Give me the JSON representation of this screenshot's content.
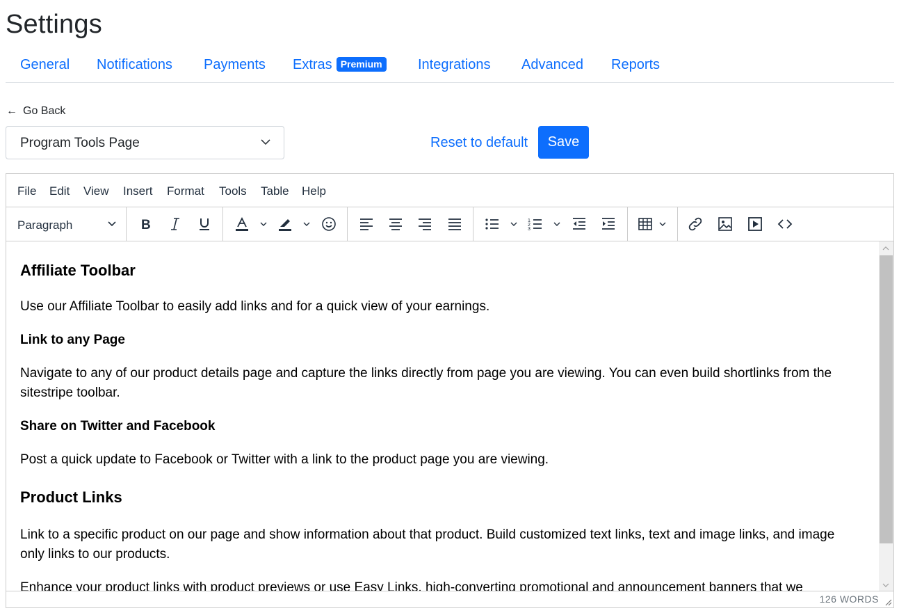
{
  "page": {
    "title": "Settings"
  },
  "tabs": [
    {
      "label": "General"
    },
    {
      "label": "Notifications"
    },
    {
      "label": "Payments"
    },
    {
      "label": "Extras",
      "badge": "Premium"
    },
    {
      "label": "Integrations"
    },
    {
      "label": "Advanced"
    },
    {
      "label": "Reports"
    }
  ],
  "go_back": {
    "arrow": "←",
    "label": "Go Back"
  },
  "page_select": {
    "value": "Program Tools Page"
  },
  "actions": {
    "reset_label": "Reset to default",
    "save_label": "Save"
  },
  "editor": {
    "menu": [
      "File",
      "Edit",
      "View",
      "Insert",
      "Format",
      "Tools",
      "Table",
      "Help"
    ],
    "block_format": "Paragraph",
    "toolbar_icons": [
      "bold-icon",
      "italic-icon",
      "underline-icon",
      "text-color-icon",
      "highlight-color-icon",
      "emoji-icon",
      "align-left-icon",
      "align-center-icon",
      "align-right-icon",
      "align-justify-icon",
      "bullet-list-icon",
      "numbered-list-icon",
      "outdent-icon",
      "indent-icon",
      "table-icon",
      "link-icon",
      "image-icon",
      "media-icon",
      "source-code-icon"
    ],
    "content": {
      "h1": "Affiliate Toolbar",
      "p1": "Use our Affiliate Toolbar to easily add links and for a quick view of your earnings.",
      "h2": "Link to any Page",
      "p2": "Navigate to any of our product details page and capture the links directly from page you are viewing. You can even build shortlinks from the sitestripe toolbar.",
      "h3": "Share on Twitter and Facebook",
      "p3": "Post a quick update to Facebook or Twitter with a link to the product page you are viewing.",
      "h4": "Product Links",
      "p4": "Link to a specific product on our page and show information about that product. Build customized text links, text and image links, and image only links to our products.",
      "p5": "Enhance your product links with product previews or use Easy Links, high-converting promotional and announcement banners that we"
    },
    "word_count": "126 WORDS"
  },
  "colors": {
    "accent": "#0d6efd",
    "border": "#cccccc",
    "text": "#212529"
  }
}
